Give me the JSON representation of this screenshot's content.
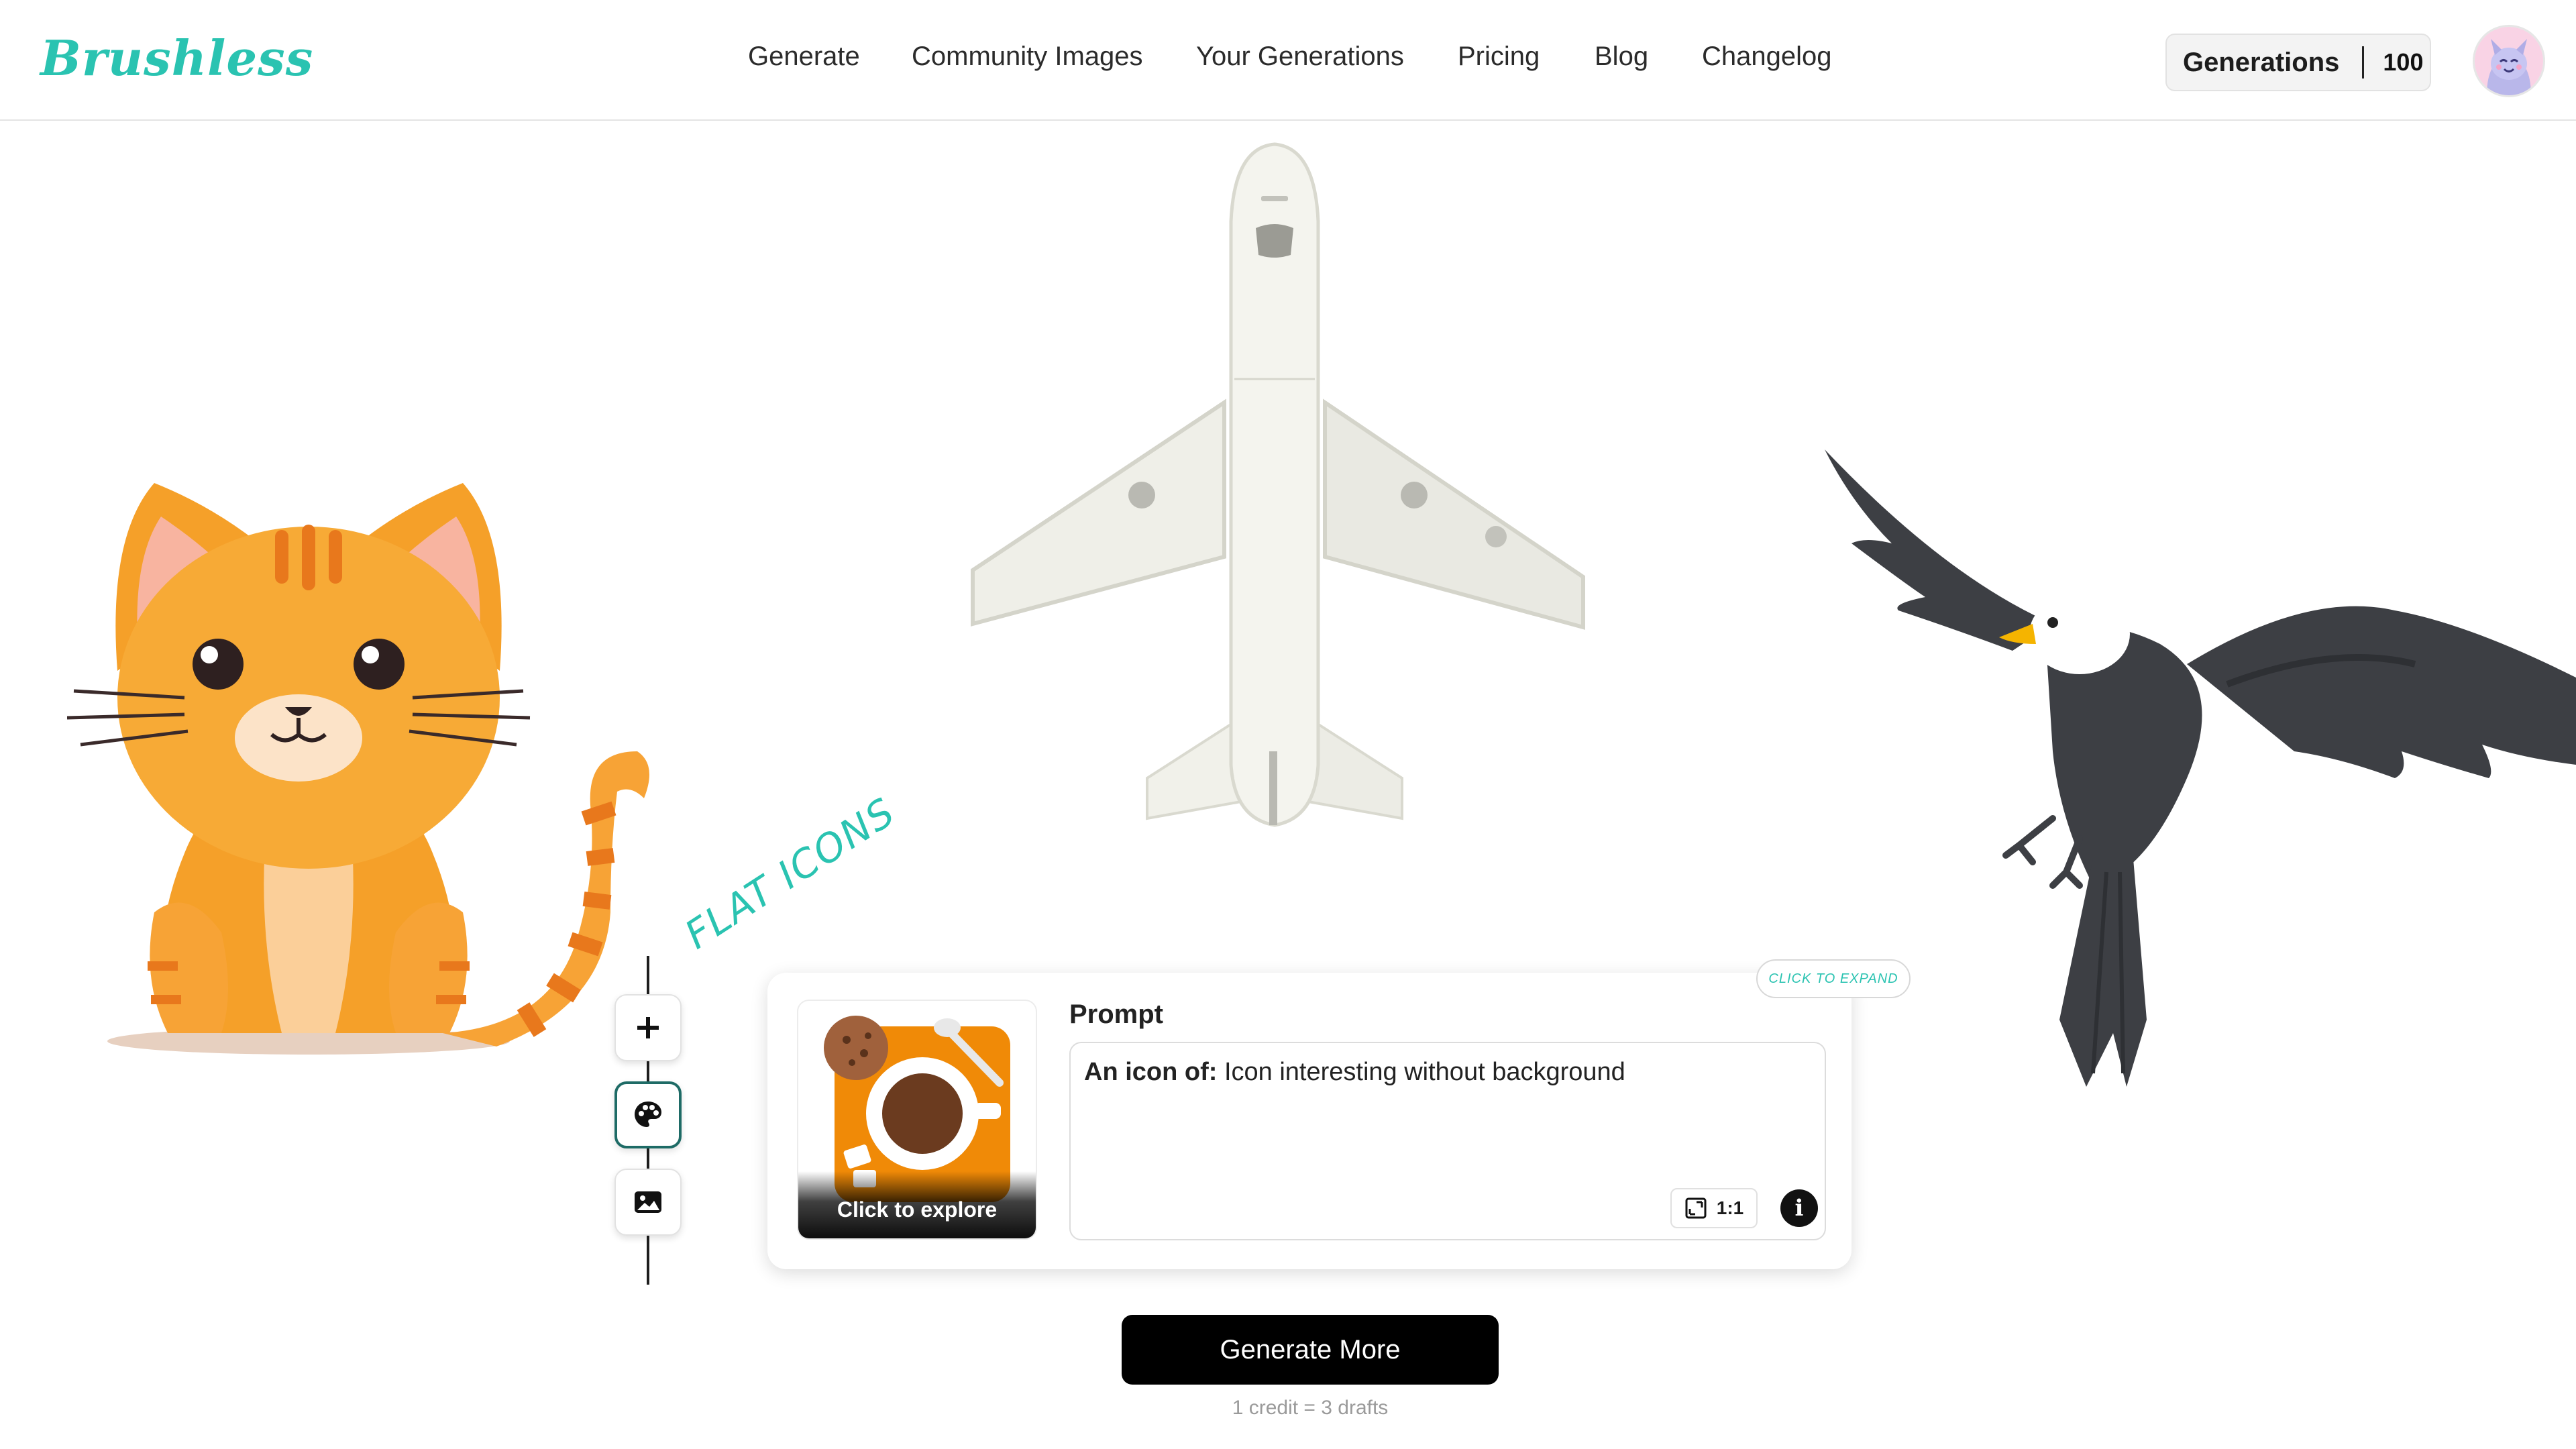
{
  "app": {
    "logo": "Brushless"
  },
  "nav": {
    "items": [
      {
        "label": "Generate"
      },
      {
        "label": "Community Images"
      },
      {
        "label": "Your Generations"
      },
      {
        "label": "Pricing"
      },
      {
        "label": "Blog"
      },
      {
        "label": "Changelog"
      }
    ]
  },
  "credits": {
    "label": "Generations",
    "count": "100"
  },
  "illustrations": [
    {
      "subject": "orange cat",
      "icon": "cat-illustration"
    },
    {
      "subject": "airplane",
      "icon": "airplane-illustration"
    },
    {
      "subject": "eagle",
      "icon": "eagle-illustration"
    }
  ],
  "tools": [
    {
      "icon": "plus-icon"
    },
    {
      "icon": "palette-icon",
      "active": true
    },
    {
      "icon": "image-icon"
    }
  ],
  "style": {
    "tag": "FLAT ICONS",
    "expand_hint": "CLICK TO EXPAND",
    "thumbnail_caption": "Click to explore"
  },
  "prompt": {
    "label": "Prompt",
    "prefix": "An icon of:",
    "value": "Icon interesting without background",
    "aspect_ratio": "1:1",
    "info_symbol": "i"
  },
  "actions": {
    "generate_label": "Generate More",
    "cost_note": "1 credit = 3 drafts"
  },
  "colors": {
    "accent": "#2ac3b1",
    "button_bg": "#000000",
    "active_tool_border": "#1e6b66"
  }
}
